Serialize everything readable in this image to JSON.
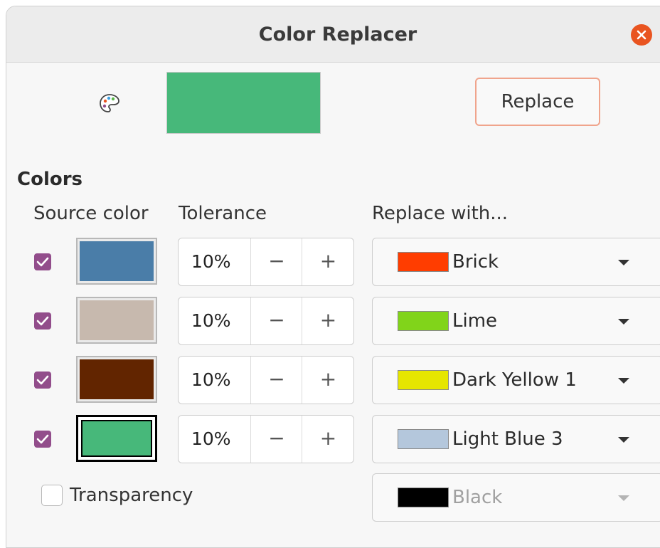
{
  "window": {
    "title": "Color Replacer"
  },
  "toolbar": {
    "preview_color": "#47b87a",
    "replace_label": "Replace"
  },
  "section": {
    "label": "Colors"
  },
  "columns": {
    "source": "Source color",
    "tolerance": "Tolerance",
    "replace": "Replace with..."
  },
  "rows": [
    {
      "checked": true,
      "source_color": "#4a7da8",
      "tolerance": "10%",
      "replace_label": "Brick",
      "replace_color": "#ff3d00",
      "selected": false
    },
    {
      "checked": true,
      "source_color": "#c7b9ae",
      "tolerance": "10%",
      "replace_label": "Lime",
      "replace_color": "#81d41a",
      "selected": false
    },
    {
      "checked": true,
      "source_color": "#622500",
      "tolerance": "10%",
      "replace_label": "Dark Yellow 1",
      "replace_color": "#e6e600",
      "selected": false
    },
    {
      "checked": true,
      "source_color": "#47b87a",
      "tolerance": "10%",
      "replace_label": "Light Blue 3",
      "replace_color": "#b4c7dc",
      "selected": true
    }
  ],
  "spin": {
    "minus": "−",
    "plus": "+"
  },
  "transparency": {
    "label": "Transparency",
    "checked": false,
    "replace_label": "Black",
    "replace_color": "#000000"
  },
  "icons": {
    "close": "close-icon",
    "palette": "palette-icon",
    "check": "checkmark-icon",
    "dropdown": "chevron-down-icon"
  },
  "colors": {
    "accent": "#e95420",
    "checkbox": "#924d8b",
    "replace_border": "#f0a48c"
  }
}
